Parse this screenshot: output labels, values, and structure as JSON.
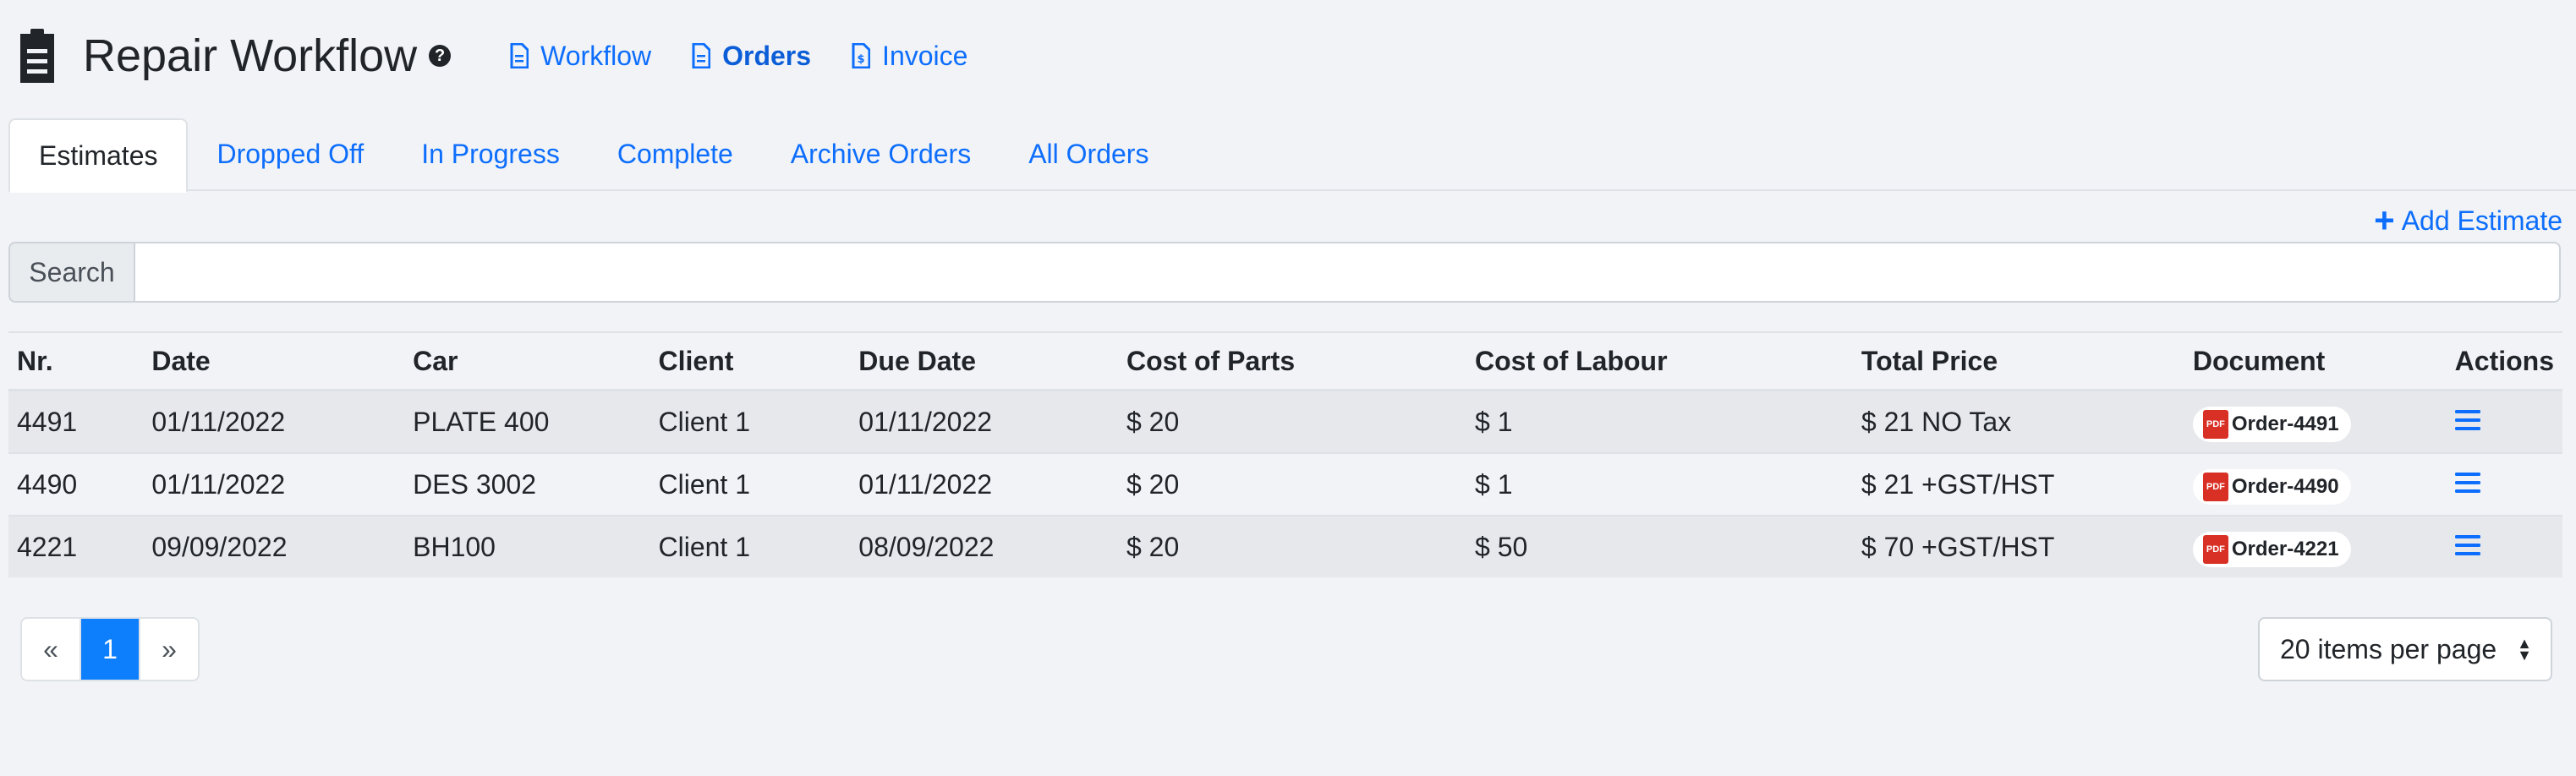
{
  "header": {
    "title": "Repair Workflow",
    "help": "?",
    "nav": [
      {
        "label": "Workflow",
        "active": false
      },
      {
        "label": "Orders",
        "active": true
      },
      {
        "label": "Invoice",
        "active": false
      }
    ]
  },
  "tabs": [
    "Estimates",
    "Dropped Off",
    "In Progress",
    "Complete",
    "Archive Orders",
    "All Orders"
  ],
  "add_estimate": "Add Estimate",
  "search": {
    "label": "Search",
    "value": "",
    "placeholder": ""
  },
  "table": {
    "headers": [
      "Nr.",
      "Date",
      "Car",
      "Client",
      "Due Date",
      "Cost of Parts",
      "Cost of Labour",
      "Total Price",
      "Document",
      "Actions"
    ],
    "rows": [
      {
        "nr": "4491",
        "date": "01/11/2022",
        "car": "PLATE 400",
        "client": "Client 1",
        "due": "01/11/2022",
        "parts": "$ 20",
        "labour": "$ 1",
        "total": "$ 21 NO Tax",
        "doc": "Order-4491"
      },
      {
        "nr": "4490",
        "date": "01/11/2022",
        "car": "DES 3002",
        "client": "Client 1",
        "due": "01/11/2022",
        "parts": "$ 20",
        "labour": "$ 1",
        "total": "$ 21 +GST/HST",
        "doc": "Order-4490"
      },
      {
        "nr": "4221",
        "date": "09/09/2022",
        "car": "BH100",
        "client": "Client 1",
        "due": "08/09/2022",
        "parts": "$ 20",
        "labour": "$ 50",
        "total": "$ 70 +GST/HST",
        "doc": "Order-4221"
      }
    ],
    "pdf_label": "PDF"
  },
  "pagination": {
    "prev": "«",
    "current": "1",
    "next": "»"
  },
  "per_page": "20 items per page",
  "colors": {
    "accent": "#0d6efd",
    "pdf": "#d93025"
  },
  "icons": {
    "title": "clipboard-icon",
    "workflow": "file-icon",
    "orders": "file-text-icon",
    "invoice": "file-invoice-icon",
    "actions": "menu-icon"
  }
}
